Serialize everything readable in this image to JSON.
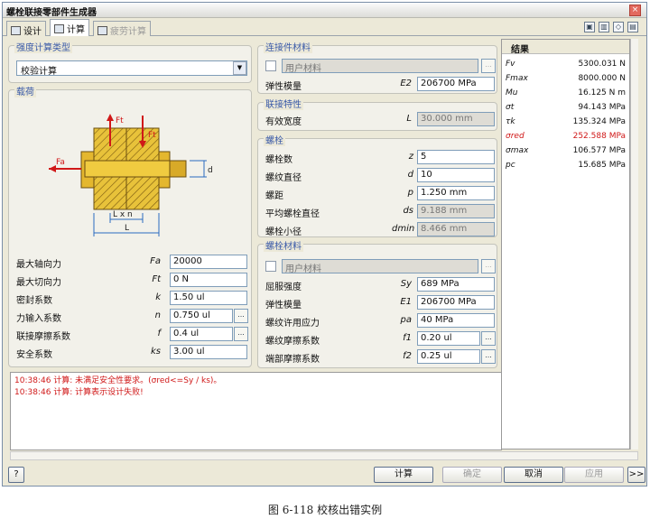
{
  "window": {
    "title": "螺栓联接零部件生成器",
    "close": "×"
  },
  "tabs": [
    {
      "label": "设计"
    },
    {
      "label": "计算"
    },
    {
      "label": "疲劳计算"
    }
  ],
  "calc_type": {
    "title": "强度计算类型",
    "value": "校验计算"
  },
  "load": {
    "title": "载荷",
    "diagram": {
      "ft": "Ft",
      "fa": "Fa",
      "d": "d",
      "lxn": "L x n",
      "l": "L"
    },
    "rows": [
      {
        "label": "最大轴向力",
        "sym": "Fa",
        "value": "20000",
        "dots": false
      },
      {
        "label": "最大切向力",
        "sym": "Ft",
        "value": "0 N",
        "dots": false
      },
      {
        "label": "密封系数",
        "sym": "k",
        "value": "1.50 ul",
        "dots": false
      },
      {
        "label": "力输入系数",
        "sym": "n",
        "value": "0.750 ul",
        "dots": true
      },
      {
        "label": "联接摩擦系数",
        "sym": "f",
        "value": "0.4 ul",
        "dots": true
      },
      {
        "label": "安全系数",
        "sym": "ks",
        "value": "3.00 ul",
        "dots": false
      }
    ]
  },
  "joined_material": {
    "title": "连接件材料",
    "user_material": "用户材料",
    "rows": [
      {
        "label": "弹性模量",
        "sym": "E2",
        "value": "206700 MPa"
      }
    ]
  },
  "joint": {
    "title": "联接特性",
    "rows": [
      {
        "label": "有效宽度",
        "sym": "L",
        "value": "30.000 mm"
      }
    ]
  },
  "bolt": {
    "title": "螺栓",
    "rows": [
      {
        "label": "螺栓数",
        "sym": "z",
        "value": "5",
        "dis": false
      },
      {
        "label": "螺纹直径",
        "sym": "d",
        "value": "10",
        "dis": false
      },
      {
        "label": "螺距",
        "sym": "p",
        "value": "1.250 mm",
        "dis": false
      },
      {
        "label": "平均螺栓直径",
        "sym": "ds",
        "value": "9.188 mm",
        "dis": true
      },
      {
        "label": "螺栓小径",
        "sym": "dmin",
        "value": "8.466 mm",
        "dis": true
      }
    ]
  },
  "bolt_material": {
    "title": "螺栓材料",
    "user_material": "用户材料",
    "rows": [
      {
        "label": "屈服强度",
        "sym": "Sy",
        "value": "689 MPa",
        "dots": false
      },
      {
        "label": "弹性模量",
        "sym": "E1",
        "value": "206700 MPa",
        "dots": false
      },
      {
        "label": "螺纹许用应力",
        "sym": "pa",
        "value": "40 MPa",
        "dots": false
      },
      {
        "label": "螺纹摩擦系数",
        "sym": "f1",
        "value": "0.20 ul",
        "dots": true
      },
      {
        "label": "端部摩擦系数",
        "sym": "f2",
        "value": "0.25 ul",
        "dots": true
      }
    ]
  },
  "results": {
    "title": "结果",
    "rows": [
      {
        "name": "Fv",
        "value": "5300.031 N",
        "red": false
      },
      {
        "name": "Fmax",
        "value": "8000.000 N",
        "red": false
      },
      {
        "name": "Mu",
        "value": "16.125 N m",
        "red": false
      },
      {
        "name": "σt",
        "value": "94.143 MPa",
        "red": false
      },
      {
        "name": "τk",
        "value": "135.324 MPa",
        "red": false
      },
      {
        "name": "σred",
        "value": "252.588 MPa",
        "red": true
      },
      {
        "name": "σmax",
        "value": "106.577 MPa",
        "red": false
      },
      {
        "name": "pc",
        "value": "15.685 MPa",
        "red": false
      }
    ]
  },
  "log": [
    "10:38:46 计算: 未满足安全性要求。(σred<=Sy / ks)。",
    "10:38:46 计算: 计算表示设计失败!"
  ],
  "buttons": {
    "calculate": "计算",
    "ok": "确定",
    "cancel": "取消",
    "apply": "应用",
    "more": ">>"
  },
  "dots": "...",
  "caption": "图 6-118  校核出错实例"
}
